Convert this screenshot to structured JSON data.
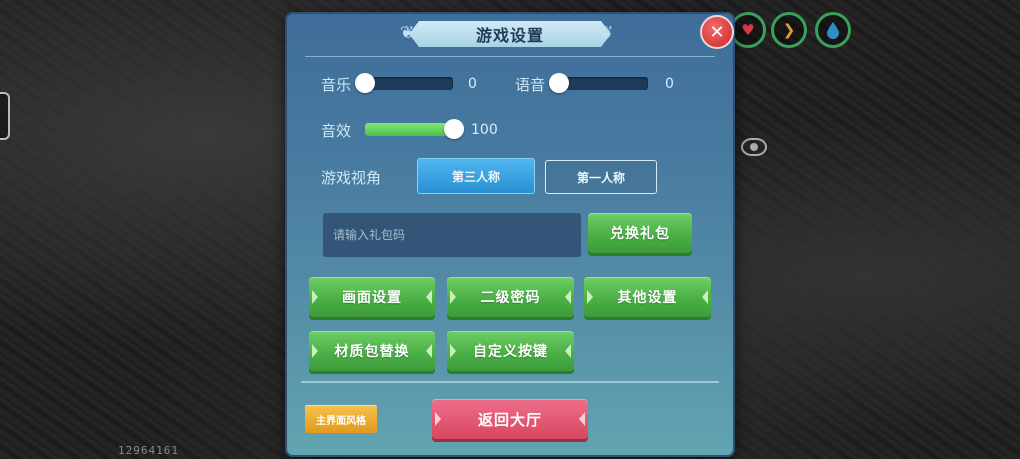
{
  "background": {
    "id_text": "12964161",
    "hud": [
      {
        "name": "heart-icon",
        "glyph": "♥",
        "color": "#d63b4a"
      },
      {
        "name": "food-icon",
        "glyph": "❯",
        "color": "#e0a02c"
      },
      {
        "name": "water-drop-icon",
        "glyph": "💧",
        "color": "#2e8ec9"
      }
    ]
  },
  "dialog": {
    "title": "游戏设置",
    "close_glyph": "✕"
  },
  "audio": {
    "music": {
      "label": "音乐",
      "value": "0",
      "level": 0
    },
    "voice": {
      "label": "语音",
      "value": "0",
      "level": 0
    },
    "sfx": {
      "label": "音效",
      "value": "100",
      "level": 100
    }
  },
  "view": {
    "label": "游戏视角",
    "options": [
      "第三人称",
      "第一人称"
    ],
    "selected": "第三人称"
  },
  "gift": {
    "placeholder": "请输入礼包码",
    "redeem_label": "兑换礼包"
  },
  "menu": {
    "graphics_settings": "画面设置",
    "secondary_password": "二级密码",
    "other_settings": "其他设置",
    "resource_pack": "材质包替换",
    "custom_keys": "自定义按键"
  },
  "footer": {
    "skin_label": "主界面风格",
    "lobby_label": "返回大厅"
  },
  "colors": {
    "accent_green": "#4ab046",
    "selected_blue": "#2a8fd2",
    "lobby_red": "#d8475f",
    "skin_orange": "#e29a1b"
  }
}
